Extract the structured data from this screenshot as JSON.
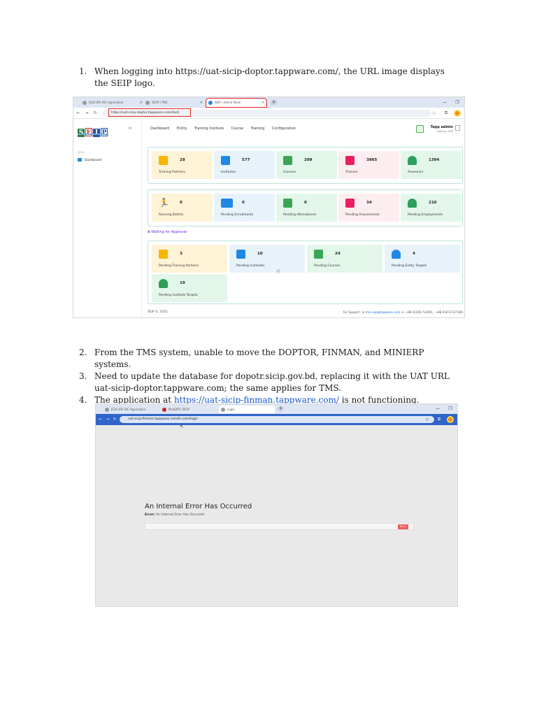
{
  "doc": {
    "item1": {
      "num": "1.",
      "text": "When logging into https://uat-sicip-doptor.tappware.com/, the URL image displays the SEIP logo."
    },
    "item2": {
      "num": "2.",
      "text": "From the TMS system, unable to move the DOPTOR, FINMAN, and MINIERP systems."
    },
    "item3": {
      "num": "3.",
      "text": "Need to update the database for dopotr.sicip.gov.bd, replacing it with the UAT URL uat-sicip-doptor.tappware.com; the same applies for TMS."
    },
    "item4": {
      "num": "4.",
      "pre": "The application at ",
      "link": "https://uat-sicip-finman.tappware.com/",
      "post": " is not functioning."
    }
  },
  "shot1": {
    "tabs": [
      "EGIC-IRC-IRC Application",
      "SICIP | TMS",
      "SEIP | Admin Panel"
    ],
    "url": "https://uat-sicip-doptor.tappware.com/dash",
    "logo": [
      "S",
      "E",
      "I",
      "P"
    ],
    "menu_label": "MENU",
    "menu_item": "Dashboard",
    "nav": [
      "Dashboard",
      "Entity",
      "Training Institute",
      "Course",
      "Training",
      "Configuration"
    ],
    "user_name": "Tapp admin",
    "user_role": "monitor, SEIP",
    "row1": [
      {
        "value": "28",
        "label": "Training Partners"
      },
      {
        "value": "577",
        "label": "Institutes"
      },
      {
        "value": "209",
        "label": "Courses"
      },
      {
        "value": "3865",
        "label": "Trainers"
      },
      {
        "value": "1394",
        "label": "Assessors"
      }
    ],
    "row2": [
      {
        "value": "0",
        "label": "Running Batchs"
      },
      {
        "value": "0",
        "label": "Pending Enrollments"
      },
      {
        "value": "0",
        "label": "Pending Attendances"
      },
      {
        "value": "34",
        "label": "Pending Assessments"
      },
      {
        "value": "210",
        "label": "Pending Employments"
      }
    ],
    "waiting": "⧗ Waiting for Approval",
    "row3": [
      {
        "value": "3",
        "label": "Pending Training Partners"
      },
      {
        "value": "10",
        "label": "Pending Institutes"
      },
      {
        "value": "24",
        "label": "Pending Courses"
      },
      {
        "value": "4",
        "label": "Pending Entity Targets"
      },
      {
        "value": "19",
        "label": "Pending Institute Targets"
      }
    ],
    "footer_left": "SEIP © 2025",
    "footer_support": "For Support : ✉",
    "footer_email": "tms.seip@tappware.com",
    "footer_phone": "☏ +88 01304-733061 , +88 01873-527366"
  },
  "shot2": {
    "tabs": [
      "EGIC-IRC-IRC Application",
      "MiniERP | SICIP",
      "Login"
    ],
    "url": "uat-sicip-finman.tappware.com/fn-user/login",
    "error_title": "An Internal Error Has Occurred",
    "error_label": "Error:",
    "error_text": "An Internal Error Has Occurred",
    "button": "Back"
  }
}
